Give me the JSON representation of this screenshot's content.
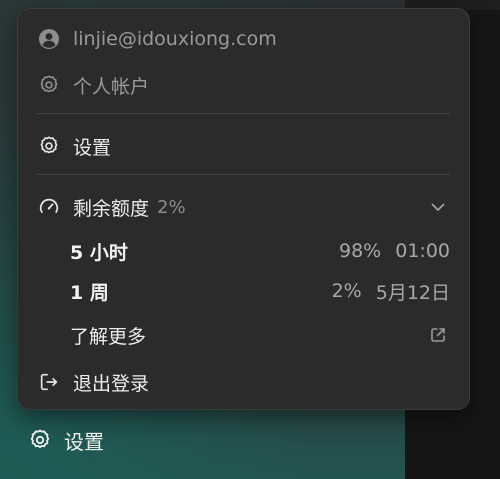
{
  "menu": {
    "account_email": "linjie@idouxiong.com",
    "personal_account": "个人帐户",
    "settings": "设置",
    "quota": {
      "label": "剩余额度",
      "percent": "2%",
      "expanded": true,
      "rows": [
        {
          "period": "5 小时",
          "percent": "98%",
          "reset": "01:00"
        },
        {
          "period": "1 周",
          "percent": "2%",
          "reset": "5月12日"
        }
      ]
    },
    "learn_more": "了解更多",
    "logout": "退出登录"
  },
  "sidebar": {
    "settings": "设置"
  },
  "icons": {
    "account": "user-circle-icon",
    "personal_account": "gear-icon",
    "settings": "gear-icon",
    "quota": "speedometer-icon",
    "quota_toggle": "chevron-down-icon",
    "learn_more": "external-link-icon",
    "logout": "logout-icon"
  },
  "colors": {
    "menu_bg": "#2b2b2b",
    "text": "#ececec",
    "muted": "#9a9a9a",
    "divider": "#444444"
  }
}
